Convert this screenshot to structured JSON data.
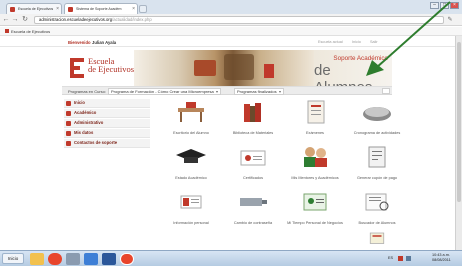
{
  "browser": {
    "tabs": [
      {
        "label": "Escuela de Ejecutivos"
      },
      {
        "label": "Sistema de Soporte Académ"
      }
    ],
    "url_host": "administracion.escueladeejecutivos.org",
    "url_path": "/actualidad/index.php",
    "bookmark": "Escuela de Ejecutivos"
  },
  "site_top": {
    "welcome": "Bienvenido",
    "user": "Julian Ayala",
    "right_links": [
      "Escuela actual",
      "Inicio",
      "Salir"
    ]
  },
  "header": {
    "logo_line1": "Escuela",
    "logo_line2": "de Ejecutivos",
    "soporte": "Soporte Académico",
    "alumnos": "de Alumnos"
  },
  "program_bar": {
    "label": "Programas en Curso:",
    "program": "Programa de Formación - Cómo Crear una Microempresa",
    "finished": "Programas finalizados"
  },
  "sidebar": {
    "items": [
      {
        "label": "Inicio"
      },
      {
        "label": "Académico"
      },
      {
        "label": "Administrativo"
      },
      {
        "label": "Mis datos"
      },
      {
        "label": "Contactos de soporte"
      }
    ]
  },
  "tiles": [
    {
      "label": "Escritorio del Alumno",
      "icon": "desk-icon"
    },
    {
      "label": "Biblioteca de Materiales",
      "icon": "books-icon"
    },
    {
      "label": "Exámenes",
      "icon": "exam-icon"
    },
    {
      "label": "Cronograma de actividades",
      "icon": "calendar-icon"
    },
    {
      "label": "Estado Académico",
      "icon": "graduation-cap-icon"
    },
    {
      "label": "Certificados",
      "icon": "certificate-icon"
    },
    {
      "label": "Mis Mentores y Académicos",
      "icon": "mentors-icon"
    },
    {
      "label": "Generar cupón de pago",
      "icon": "payment-coupon-icon"
    },
    {
      "label": "Información personal",
      "icon": "personal-info-icon"
    },
    {
      "label": "Cambio de contraseña",
      "icon": "password-icon"
    },
    {
      "label": "Mi Tiempo Personal de Negocios",
      "icon": "id-card-icon"
    },
    {
      "label": "Buscador de Alumnos",
      "icon": "search-students-icon"
    },
    {
      "label": "",
      "icon": "support-icon"
    }
  ],
  "taskbar": {
    "start": "Inicio",
    "lang": "ES",
    "time": "10:43 a.m.",
    "date": "08/08/2011"
  },
  "colors": {
    "brand_red": "#c0392b",
    "arrow_green": "#2e7d2e"
  }
}
